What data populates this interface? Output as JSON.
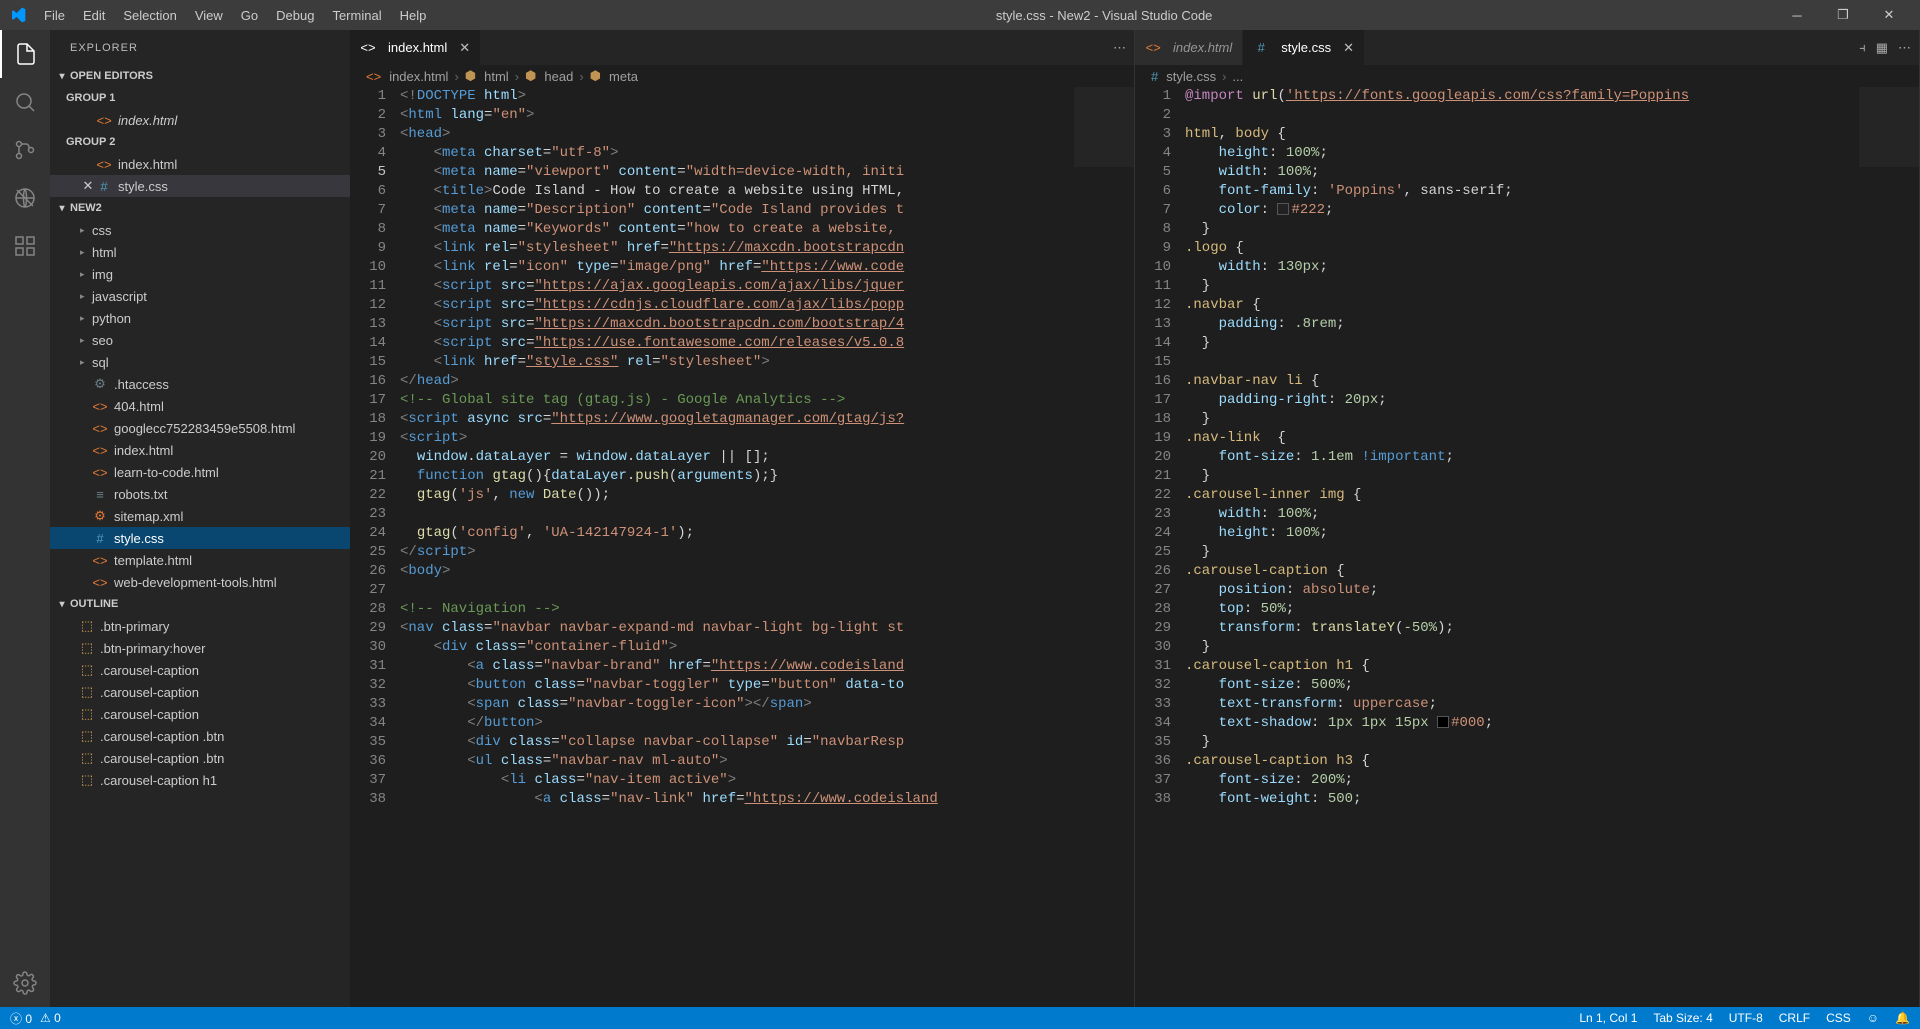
{
  "title": "style.css - New2 - Visual Studio Code",
  "menu": [
    "File",
    "Edit",
    "Selection",
    "View",
    "Go",
    "Debug",
    "Terminal",
    "Help"
  ],
  "sidebar": {
    "title": "EXPLORER",
    "open_editors_label": "OPEN EDITORS",
    "groups": [
      {
        "label": "GROUP 1",
        "files": [
          {
            "name": "index.html",
            "icon": "html",
            "italic": true
          }
        ]
      },
      {
        "label": "GROUP 2",
        "files": [
          {
            "name": "index.html",
            "icon": "html"
          },
          {
            "name": "style.css",
            "icon": "css",
            "active": true,
            "close": true
          }
        ]
      }
    ],
    "workspace_label": "NEW2",
    "tree": [
      {
        "name": "css",
        "type": "folder"
      },
      {
        "name": "html",
        "type": "folder"
      },
      {
        "name": "img",
        "type": "folder"
      },
      {
        "name": "javascript",
        "type": "folder"
      },
      {
        "name": "python",
        "type": "folder"
      },
      {
        "name": "seo",
        "type": "folder"
      },
      {
        "name": "sql",
        "type": "folder"
      },
      {
        "name": ".htaccess",
        "type": "file",
        "icon": "gear"
      },
      {
        "name": "404.html",
        "type": "file",
        "icon": "html"
      },
      {
        "name": "googlecc752283459e5508.html",
        "type": "file",
        "icon": "html"
      },
      {
        "name": "index.html",
        "type": "file",
        "icon": "html"
      },
      {
        "name": "learn-to-code.html",
        "type": "file",
        "icon": "html"
      },
      {
        "name": "robots.txt",
        "type": "file",
        "icon": "txt"
      },
      {
        "name": "sitemap.xml",
        "type": "file",
        "icon": "xml"
      },
      {
        "name": "style.css",
        "type": "file",
        "icon": "css",
        "selected": true
      },
      {
        "name": "template.html",
        "type": "file",
        "icon": "html"
      },
      {
        "name": "web-development-tools.html",
        "type": "file",
        "icon": "html"
      }
    ],
    "outline_label": "OUTLINE",
    "outline": [
      ".btn-primary",
      ".btn-primary:hover",
      ".carousel-caption",
      ".carousel-caption",
      ".carousel-caption",
      ".carousel-caption .btn",
      ".carousel-caption .btn",
      ".carousel-caption h1"
    ]
  },
  "editor1": {
    "tab": {
      "name": "index.html",
      "icon": "html"
    },
    "breadcrumb": [
      "index.html",
      "html",
      "head",
      "meta"
    ],
    "active_line": 5,
    "lines": [
      {
        "n": 1,
        "html": "<span class='t-pun'>&lt;!</span><span class='t-doctype'>DOCTYPE</span> <span class='t-attr'>html</span><span class='t-pun'>&gt;</span>"
      },
      {
        "n": 2,
        "html": "<span class='t-pun'>&lt;</span><span class='t-tag'>html</span> <span class='t-attr'>lang</span>=<span class='t-str'>\"en\"</span><span class='t-pun'>&gt;</span>"
      },
      {
        "n": 3,
        "html": "<span class='t-pun'>&lt;</span><span class='t-tag'>head</span><span class='t-pun'>&gt;</span>"
      },
      {
        "n": 4,
        "html": "    <span class='t-pun'>&lt;</span><span class='t-tag'>meta</span> <span class='t-attr'>charset</span>=<span class='t-str'>\"utf-8\"</span><span class='t-pun'>&gt;</span>"
      },
      {
        "n": 5,
        "html": "    <span class='t-pun'>&lt;</span><span class='t-tag'>meta</span> <span class='t-attr'>name</span>=<span class='t-str'>\"viewport\"</span> <span class='t-attr'>content</span>=<span class='t-str'>\"width=device-width, initi</span>"
      },
      {
        "n": 6,
        "html": "    <span class='t-pun'>&lt;</span><span class='t-tag'>title</span><span class='t-pun'>&gt;</span>Code Island - How to create a website using HTML,"
      },
      {
        "n": 7,
        "html": "    <span class='t-pun'>&lt;</span><span class='t-tag'>meta</span> <span class='t-attr'>name</span>=<span class='t-str'>\"Description\"</span> <span class='t-attr'>content</span>=<span class='t-str'>\"Code Island provides t</span>"
      },
      {
        "n": 8,
        "html": "    <span class='t-pun'>&lt;</span><span class='t-tag'>meta</span> <span class='t-attr'>name</span>=<span class='t-str'>\"Keywords\"</span> <span class='t-attr'>content</span>=<span class='t-str'>\"how to create a website, </span>"
      },
      {
        "n": 9,
        "html": "    <span class='t-pun'>&lt;</span><span class='t-tag'>link</span> <span class='t-attr'>rel</span>=<span class='t-str'>\"stylesheet\"</span> <span class='t-attr'>href</span>=<span class='t-url'>\"https://maxcdn.bootstrapcdn</span>"
      },
      {
        "n": 10,
        "html": "    <span class='t-pun'>&lt;</span><span class='t-tag'>link</span> <span class='t-attr'>rel</span>=<span class='t-str'>\"icon\"</span> <span class='t-attr'>type</span>=<span class='t-str'>\"image/png\"</span> <span class='t-attr'>href</span>=<span class='t-url'>\"https://www.code</span>"
      },
      {
        "n": 11,
        "html": "    <span class='t-pun'>&lt;</span><span class='t-tag'>script</span> <span class='t-attr'>src</span>=<span class='t-url'>\"https://ajax.googleapis.com/ajax/libs/jquer</span>"
      },
      {
        "n": 12,
        "html": "    <span class='t-pun'>&lt;</span><span class='t-tag'>script</span> <span class='t-attr'>src</span>=<span class='t-url'>\"https://cdnjs.cloudflare.com/ajax/libs/popp</span>"
      },
      {
        "n": 13,
        "html": "    <span class='t-pun'>&lt;</span><span class='t-tag'>script</span> <span class='t-attr'>src</span>=<span class='t-url'>\"https://maxcdn.bootstrapcdn.com/bootstrap/4</span>"
      },
      {
        "n": 14,
        "html": "    <span class='t-pun'>&lt;</span><span class='t-tag'>script</span> <span class='t-attr'>src</span>=<span class='t-url'>\"https://use.fontawesome.com/releases/v5.0.8</span>"
      },
      {
        "n": 15,
        "html": "    <span class='t-pun'>&lt;</span><span class='t-tag'>link</span> <span class='t-attr'>href</span>=<span class='t-url'>\"style.css\"</span> <span class='t-attr'>rel</span>=<span class='t-str'>\"stylesheet\"</span><span class='t-pun'>&gt;</span>"
      },
      {
        "n": 16,
        "html": "<span class='t-pun'>&lt;/</span><span class='t-tag'>head</span><span class='t-pun'>&gt;</span>"
      },
      {
        "n": 17,
        "html": "<span class='t-cmt'>&lt;!-- Global site tag (gtag.js) - Google Analytics --&gt;</span>"
      },
      {
        "n": 18,
        "html": "<span class='t-pun'>&lt;</span><span class='t-tag'>script</span> <span class='t-attr'>async</span> <span class='t-attr'>src</span>=<span class='t-url'>\"https://www.googletagmanager.com/gtag/js?</span>"
      },
      {
        "n": 19,
        "html": "<span class='t-pun'>&lt;</span><span class='t-tag'>script</span><span class='t-pun'>&gt;</span>"
      },
      {
        "n": 20,
        "html": "  <span class='t-prop'>window</span>.<span class='t-prop'>dataLayer</span> = <span class='t-prop'>window</span>.<span class='t-prop'>dataLayer</span> || [];"
      },
      {
        "n": 21,
        "html": "  <span class='t-kw'>function</span> <span class='t-fn'>gtag</span>(){<span class='t-prop'>dataLayer</span>.<span class='t-fn'>push</span>(<span class='t-prop'>arguments</span>);}"
      },
      {
        "n": 22,
        "html": "  <span class='t-fn'>gtag</span>(<span class='t-str'>'js'</span>, <span class='t-kw'>new</span> <span class='t-fn'>Date</span>());"
      },
      {
        "n": 23,
        "html": ""
      },
      {
        "n": 24,
        "html": "  <span class='t-fn'>gtag</span>(<span class='t-str'>'config'</span>, <span class='t-str'>'UA-142147924-1'</span>);"
      },
      {
        "n": 25,
        "html": "<span class='t-pun'>&lt;/</span><span class='t-tag'>script</span><span class='t-pun'>&gt;</span>"
      },
      {
        "n": 26,
        "html": "<span class='t-pun'>&lt;</span><span class='t-tag'>body</span><span class='t-pun'>&gt;</span>"
      },
      {
        "n": 27,
        "html": ""
      },
      {
        "n": 28,
        "html": "<span class='t-cmt'>&lt;!-- Navigation --&gt;</span>"
      },
      {
        "n": 29,
        "html": "<span class='t-pun'>&lt;</span><span class='t-tag'>nav</span> <span class='t-attr'>class</span>=<span class='t-str'>\"navbar navbar-expand-md navbar-light bg-light st</span>"
      },
      {
        "n": 30,
        "html": "    <span class='t-pun'>&lt;</span><span class='t-tag'>div</span> <span class='t-attr'>class</span>=<span class='t-str'>\"container-fluid\"</span><span class='t-pun'>&gt;</span>"
      },
      {
        "n": 31,
        "html": "        <span class='t-pun'>&lt;</span><span class='t-tag'>a</span> <span class='t-attr'>class</span>=<span class='t-str'>\"navbar-brand\"</span> <span class='t-attr'>href</span>=<span class='t-url'>\"https://www.codeisland</span>"
      },
      {
        "n": 32,
        "html": "        <span class='t-pun'>&lt;</span><span class='t-tag'>button</span> <span class='t-attr'>class</span>=<span class='t-str'>\"navbar-toggler\"</span> <span class='t-attr'>type</span>=<span class='t-str'>\"button\"</span> <span class='t-attr'>data-to</span>"
      },
      {
        "n": 33,
        "html": "        <span class='t-pun'>&lt;</span><span class='t-tag'>span</span> <span class='t-attr'>class</span>=<span class='t-str'>\"navbar-toggler-icon\"</span><span class='t-pun'>&gt;&lt;/</span><span class='t-tag'>span</span><span class='t-pun'>&gt;</span>"
      },
      {
        "n": 34,
        "html": "        <span class='t-pun'>&lt;/</span><span class='t-tag'>button</span><span class='t-pun'>&gt;</span>"
      },
      {
        "n": 35,
        "html": "        <span class='t-pun'>&lt;</span><span class='t-tag'>div</span> <span class='t-attr'>class</span>=<span class='t-str'>\"collapse navbar-collapse\"</span> <span class='t-attr'>id</span>=<span class='t-str'>\"navbarResp</span>"
      },
      {
        "n": 36,
        "html": "        <span class='t-pun'>&lt;</span><span class='t-tag'>ul</span> <span class='t-attr'>class</span>=<span class='t-str'>\"navbar-nav ml-auto\"</span><span class='t-pun'>&gt;</span>"
      },
      {
        "n": 37,
        "html": "            <span class='t-pun'>&lt;</span><span class='t-tag'>li</span> <span class='t-attr'>class</span>=<span class='t-str'>\"nav-item active\"</span><span class='t-pun'>&gt;</span>"
      },
      {
        "n": 38,
        "html": "                <span class='t-pun'>&lt;</span><span class='t-tag'>a</span> <span class='t-attr'>class</span>=<span class='t-str'>\"nav-link\"</span> <span class='t-attr'>href</span>=<span class='t-url'>\"https://www.codeisland</span>"
      }
    ]
  },
  "editor2": {
    "tabs": [
      {
        "name": "index.html",
        "icon": "html"
      },
      {
        "name": "style.css",
        "icon": "css",
        "active": true
      }
    ],
    "breadcrumb": [
      "style.css",
      "..."
    ],
    "lines": [
      {
        "n": 1,
        "html": "<span class='t-imp'>@import</span> <span class='t-fn'>url</span>(<span class='t-url'>'https://fonts.googleapis.com/css?family=Poppins</span>"
      },
      {
        "n": 2,
        "html": ""
      },
      {
        "n": 3,
        "html": "<span class='t-sel'>html</span>, <span class='t-sel'>body</span> {"
      },
      {
        "n": 4,
        "html": "    <span class='t-prop'>height</span>: <span class='t-num'>100%</span>;"
      },
      {
        "n": 5,
        "html": "    <span class='t-prop'>width</span>: <span class='t-num'>100%</span>;"
      },
      {
        "n": 6,
        "html": "    <span class='t-prop'>font-family</span>: <span class='t-str'>'Poppins'</span>, sans-serif;"
      },
      {
        "n": 7,
        "html": "    <span class='t-prop'>color</span>: <span class='color-sw' style='background:#222'></span><span class='t-color'>#222</span>;"
      },
      {
        "n": 8,
        "html": "  }"
      },
      {
        "n": 9,
        "html": "<span class='t-sel'>.logo</span> {"
      },
      {
        "n": 10,
        "html": "    <span class='t-prop'>width</span>: <span class='t-num'>130px</span>;"
      },
      {
        "n": 11,
        "html": "  }"
      },
      {
        "n": 12,
        "html": "<span class='t-sel'>.navbar</span> {"
      },
      {
        "n": 13,
        "html": "    <span class='t-prop'>padding</span>: <span class='t-num'>.8rem</span>;"
      },
      {
        "n": 14,
        "html": "  }"
      },
      {
        "n": 15,
        "html": ""
      },
      {
        "n": 16,
        "html": "<span class='t-sel'>.navbar-nav li</span> {"
      },
      {
        "n": 17,
        "html": "    <span class='t-prop'>padding-right</span>: <span class='t-num'>20px</span>;"
      },
      {
        "n": 18,
        "html": "  }"
      },
      {
        "n": 19,
        "html": "<span class='t-sel'>.nav-link</span>  {"
      },
      {
        "n": 20,
        "html": "    <span class='t-prop'>font-size</span>: <span class='t-num'>1.1em</span> <span class='t-kw'>!important</span>;"
      },
      {
        "n": 21,
        "html": "  }"
      },
      {
        "n": 22,
        "html": "<span class='t-sel'>.carousel-inner img</span> {"
      },
      {
        "n": 23,
        "html": "    <span class='t-prop'>width</span>: <span class='t-num'>100%</span>;"
      },
      {
        "n": 24,
        "html": "    <span class='t-prop'>height</span>: <span class='t-num'>100%</span>;"
      },
      {
        "n": 25,
        "html": "  }"
      },
      {
        "n": 26,
        "html": "<span class='t-sel'>.carousel-caption</span> {"
      },
      {
        "n": 27,
        "html": "    <span class='t-prop'>position</span>: <span class='t-str'>absolute</span>;"
      },
      {
        "n": 28,
        "html": "    <span class='t-prop'>top</span>: <span class='t-num'>50%</span>;"
      },
      {
        "n": 29,
        "html": "    <span class='t-prop'>transform</span>: <span class='t-fn'>translateY</span>(<span class='t-num'>-50%</span>);"
      },
      {
        "n": 30,
        "html": "  }"
      },
      {
        "n": 31,
        "html": "<span class='t-sel'>.carousel-caption h1</span> {"
      },
      {
        "n": 32,
        "html": "    <span class='t-prop'>font-size</span>: <span class='t-num'>500%</span>;"
      },
      {
        "n": 33,
        "html": "    <span class='t-prop'>text-transform</span>: <span class='t-str'>uppercase</span>;"
      },
      {
        "n": 34,
        "html": "    <span class='t-prop'>text-shadow</span>: <span class='t-num'>1px 1px 15px</span> <span class='color-sw' style='background:#000'></span><span class='t-color'>#000</span>;"
      },
      {
        "n": 35,
        "html": "  }"
      },
      {
        "n": 36,
        "html": "<span class='t-sel'>.carousel-caption h3</span> {"
      },
      {
        "n": 37,
        "html": "    <span class='t-prop'>font-size</span>: <span class='t-num'>200%</span>;"
      },
      {
        "n": 38,
        "html": "    <span class='t-prop'>font-weight</span>: <span class='t-num'>500</span>;"
      }
    ]
  },
  "status": {
    "errors": "0",
    "warnings": "0",
    "cursor": "Ln 1, Col 1",
    "tabsize": "Tab Size: 4",
    "encoding": "UTF-8",
    "eol": "CRLF",
    "lang": "CSS"
  }
}
